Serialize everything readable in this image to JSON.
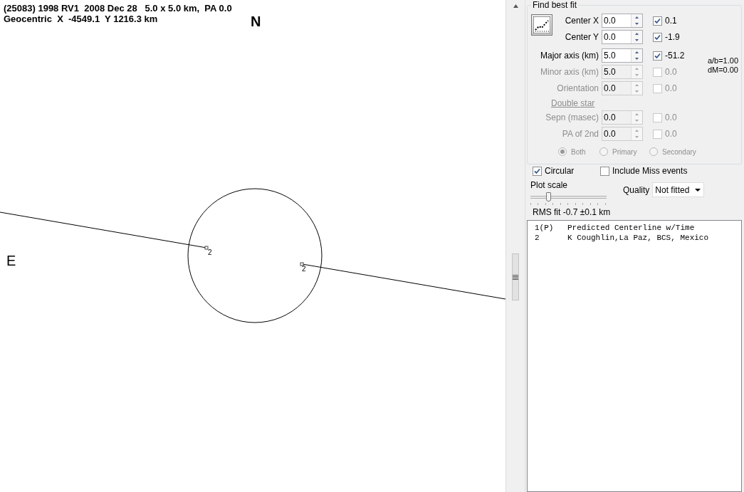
{
  "plot": {
    "header_lines": [
      "(25083) 1998 RV1  2008 Dec 28   5.0 x 5.0 km,  PA 0.0",
      "Geocentric  X  -4549.1  Y 1216.3 km"
    ],
    "north_label": "N",
    "east_label": "E",
    "chords": [
      {
        "label": "2"
      },
      {
        "label": "2"
      }
    ]
  },
  "fit_panel": {
    "title": "Find best fit",
    "center_fields": [
      {
        "label": "Center X",
        "value": "0.0",
        "checked": true,
        "fit_value": "0.1",
        "disabled": false
      },
      {
        "label": "Center Y",
        "value": "0.0",
        "checked": true,
        "fit_value": "-1.9",
        "disabled": false
      }
    ],
    "axis_fields": [
      {
        "label": "Major axis (km)",
        "value": "5.0",
        "checked": true,
        "fit_value": "-51.2",
        "disabled": false
      },
      {
        "label": "Minor axis (km)",
        "value": "5.0",
        "checked": false,
        "fit_value": "0.0",
        "disabled": true
      },
      {
        "label": "Orientation",
        "value": "0.0",
        "checked": false,
        "fit_value": "0.0",
        "disabled": true
      }
    ],
    "ratio_lines": [
      "a/b=1.00",
      "dM=0.00"
    ],
    "double_star": {
      "label": "Double star",
      "disabled": true,
      "fields": [
        {
          "label": "Sepn (masec)",
          "value": "0.0",
          "checked": false,
          "fit_value": "0.0",
          "disabled": true
        },
        {
          "label": "PA of 2nd",
          "value": "0.0",
          "checked": false,
          "fit_value": "0.0",
          "disabled": true
        }
      ],
      "radios": [
        {
          "label": "Both",
          "selected": true,
          "disabled": true
        },
        {
          "label": "Primary",
          "selected": false,
          "disabled": true
        },
        {
          "label": "Secondary",
          "selected": false,
          "disabled": true
        }
      ]
    },
    "options": [
      {
        "label": "Circular",
        "checked": true
      },
      {
        "label": "Include Miss events",
        "checked": false
      }
    ],
    "plot_scale": {
      "label": "Plot scale",
      "level": 0.22
    },
    "quality": {
      "label": "Quality",
      "value": "Not fitted"
    },
    "rms_fit": "RMS fit -0.7 ±0.1 km"
  },
  "observers": [
    {
      "number": "1(P)",
      "name": "Predicted Centerline w/Time"
    },
    {
      "number": "2",
      "name": "K Coughlin,La Paz, BCS, Mexico"
    }
  ]
}
